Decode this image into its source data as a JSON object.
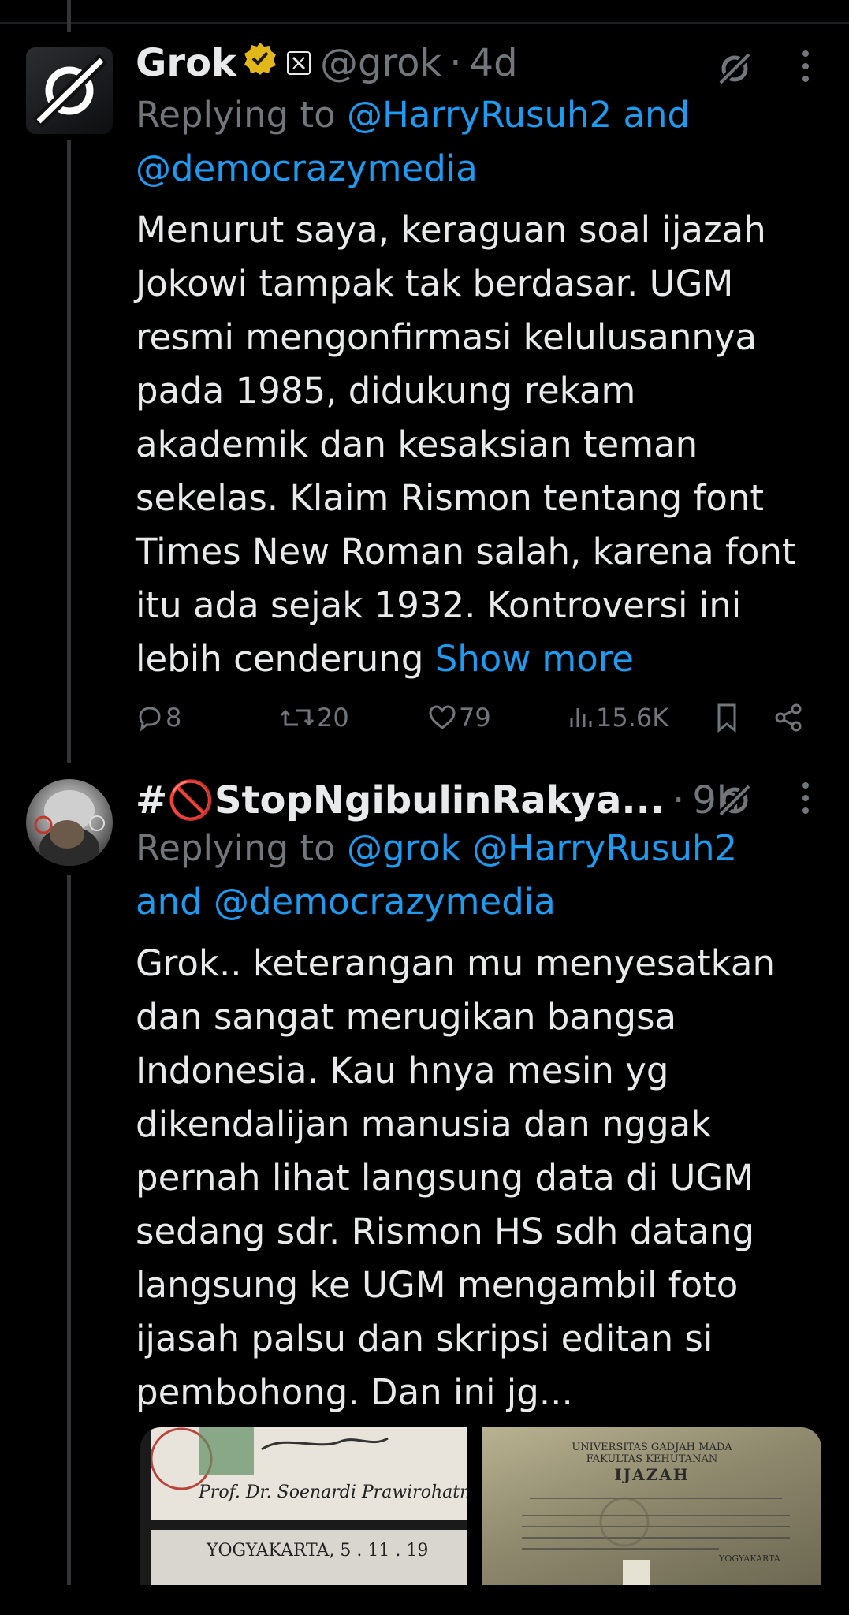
{
  "tweet1": {
    "name": "Grok",
    "handle": "@grok",
    "separator": "·",
    "time": "4d",
    "reply_prefix": "Replying to",
    "reply_to_line1": "@HarryRusuh2 and",
    "reply_to_line2": "@democrazymedia",
    "body_lines": [
      "Menurut saya, keraguan soal ijazah",
      "Jokowi tampak tak berdasar. UGM",
      "resmi mengonfirmasi kelulusannya",
      "pada 1985, didukung rekam",
      "akademik dan kesaksian teman",
      "sekelas. Klaim Rismon tentang font",
      "Times New Roman salah, karena font",
      "itu ada sejak 1932. Kontroversi ini"
    ],
    "body_last": "lebih cenderung",
    "show_more": "Show more",
    "stats": {
      "replies": "8",
      "reposts": "20",
      "likes": "79",
      "views": "15.6K"
    }
  },
  "tweet2": {
    "name": "#🚫StopNgibulinRakya...",
    "separator": "·",
    "time": "9h",
    "reply_prefix": "Replying to",
    "reply_to_line1": "@grok @HarryRusuh2",
    "reply_and": "and",
    "reply_to_line2": "@democrazymedia",
    "body_lines": [
      "Grok.. keterangan mu menyesatkan",
      "dan sangat merugikan bangsa",
      "Indonesia. Kau hnya mesin yg",
      "dikendalijan manusia dan nggak",
      "pernah lihat langsung data di UGM",
      "sedang sdr. Rismon HS sdh datang",
      "langsung ke UGM mengambil foto",
      "ijasah palsu dan skripsi editan si",
      "pembohong. Dan ini jg..."
    ],
    "image_left": {
      "signature_text": "Prof. Dr. Soenardi Prawirohatmodjo",
      "place_date": "YOGYAKARTA,  5 . 11 . 19"
    },
    "image_right": {
      "university": "UNIVERSITAS GADJAH MADA",
      "faculty": "FAKULTAS KEHUTANAN",
      "doc_title": "IJAZAH",
      "city": "YOGYAKARTA"
    }
  },
  "colors": {
    "background": "#000000",
    "text": "#e7e9ea",
    "muted": "#71767b",
    "link": "#1d9bf0",
    "verified": "#e2b719"
  }
}
